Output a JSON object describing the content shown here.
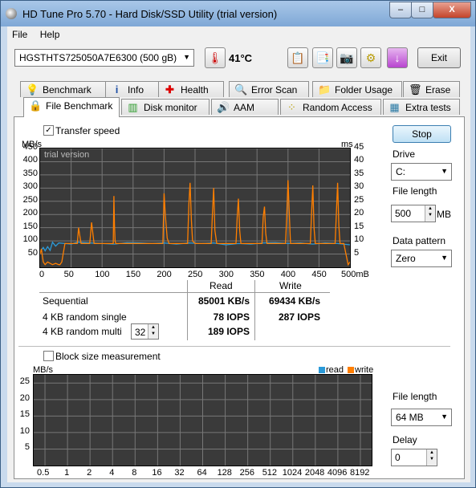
{
  "window": {
    "title": "HD Tune Pro 5.70 - Hard Disk/SSD Utility (trial version)",
    "minimize": "–",
    "maximize": "□",
    "close": "X"
  },
  "menu": [
    "File",
    "Help"
  ],
  "toolbar": {
    "drive": "HGSTHTS725050A7E6300 (500 gB)",
    "temperature": "41°C",
    "exit_label": "Exit"
  },
  "tabs_top": [
    "Benchmark",
    "Info",
    "Health",
    "Error Scan",
    "Folder Usage",
    "Erase"
  ],
  "tabs_bottom": [
    "File Benchmark",
    "Disk monitor",
    "AAM",
    "Random Access",
    "Extra tests"
  ],
  "transfer": {
    "checkbox_label": "Transfer speed",
    "left_unit": "MB/s",
    "right_unit": "ms",
    "watermark": "trial version",
    "y_ticks_left": [
      "450",
      "400",
      "350",
      "300",
      "250",
      "200",
      "150",
      "100",
      "50"
    ],
    "y_ticks_right": [
      "45",
      "40",
      "35",
      "30",
      "25",
      "20",
      "15",
      "10",
      "5"
    ],
    "x_ticks": [
      "0",
      "50",
      "100",
      "150",
      "200",
      "250",
      "300",
      "350",
      "400",
      "450",
      "500mB"
    ]
  },
  "results": {
    "col_read": "Read",
    "col_write": "Write",
    "rows": [
      {
        "label": "Sequential",
        "read": "85001 KB/s",
        "write": "69434 KB/s"
      },
      {
        "label": "4 KB random single",
        "read": "78 IOPS",
        "write": "287 IOPS"
      },
      {
        "label": "4 KB random multi",
        "read": "189 IOPS",
        "write": ""
      }
    ],
    "queue_depth": "32"
  },
  "right_panel": {
    "stop_label": "Stop",
    "drive_label": "Drive",
    "drive_value": "C:",
    "file_length_label": "File length",
    "file_length_value": "500",
    "file_length_unit": "MB",
    "data_pattern_label": "Data pattern",
    "data_pattern_value": "Zero"
  },
  "block": {
    "checkbox_label": "Block size measurement",
    "unit": "MB/s",
    "legend_read": "read",
    "legend_write": "write",
    "y_ticks": [
      "25",
      "20",
      "15",
      "10",
      "5"
    ],
    "x_ticks": [
      "0.5",
      "1",
      "2",
      "4",
      "8",
      "16",
      "32",
      "64",
      "128",
      "256",
      "512",
      "1024",
      "2048",
      "4096",
      "8192"
    ],
    "file_length_label": "File length",
    "file_length_value": "64 MB",
    "delay_label": "Delay",
    "delay_value": "0"
  },
  "colors": {
    "read": "#2b9ad8",
    "write": "#ff7f00",
    "plot_bg": "#3a3a3a",
    "grid": "#777777"
  },
  "chart_data": {
    "type": "line",
    "title": "",
    "xlabel": "",
    "ylabel": "MB/s",
    "xlim": [
      0,
      500
    ],
    "ylim": [
      0,
      450
    ],
    "y2label": "ms",
    "y2lim": [
      0,
      45
    ],
    "grid": true,
    "series": [
      {
        "axis": "left",
        "color": "#2b9ad8",
        "x": [
          0,
          5,
          8,
          12,
          16,
          20,
          25,
          30,
          40,
          50,
          60,
          80,
          100,
          120,
          140,
          160,
          180,
          200,
          220,
          240,
          260,
          280,
          300,
          320,
          340,
          360,
          380,
          400,
          420,
          440,
          460,
          480,
          500
        ],
        "y": [
          60,
          75,
          62,
          78,
          64,
          95,
          80,
          92,
          90,
          88,
          95,
          92,
          90,
          88,
          93,
          92,
          90,
          92,
          88,
          92,
          90,
          92,
          85,
          90,
          88,
          92,
          93,
          90,
          92,
          88,
          92,
          90,
          85
        ]
      },
      {
        "axis": "right",
        "color": "#ff7f00",
        "x": [
          0,
          2,
          5,
          8,
          10,
          12,
          20,
          25,
          30,
          32,
          35,
          40,
          50,
          60,
          62,
          64,
          66,
          80,
          83,
          85,
          87,
          90,
          100,
          110,
          118,
          119,
          120,
          121,
          122,
          130,
          140,
          150,
          160,
          170,
          180,
          190,
          198,
          200,
          202,
          205,
          208,
          210,
          220,
          230,
          238,
          240,
          242,
          244,
          246,
          250,
          260,
          270,
          276,
          278,
          280,
          282,
          285,
          290,
          300,
          310,
          316,
          318,
          320,
          322,
          324,
          330,
          340,
          350,
          358,
          360,
          362,
          364,
          366,
          370,
          380,
          390,
          396,
          398,
          400,
          402,
          404,
          410,
          420,
          430,
          436,
          438,
          440,
          442,
          444,
          450,
          460,
          470,
          476,
          478,
          480,
          482,
          484,
          490,
          497,
          500
        ],
        "y": [
          5,
          7,
          2,
          1,
          1.5,
          2,
          1,
          1.5,
          1,
          1,
          2,
          9,
          9,
          9,
          15,
          12,
          9,
          9,
          17,
          13,
          9,
          9,
          9,
          9,
          9,
          27,
          16,
          10,
          9,
          9,
          9,
          9,
          9,
          9,
          9,
          9,
          9,
          28,
          20,
          11,
          9,
          9,
          9,
          9,
          9,
          24,
          32,
          18,
          10,
          9,
          9,
          9,
          9,
          20,
          30,
          14,
          9,
          9,
          9,
          9,
          9,
          19,
          26,
          14,
          9,
          9,
          9,
          9,
          9,
          19,
          23,
          13,
          9,
          9,
          9,
          9,
          9,
          20,
          33,
          21,
          9,
          9,
          9,
          9,
          9,
          20,
          31,
          15,
          9,
          9,
          9,
          9,
          9,
          20,
          32,
          16,
          9,
          9,
          1,
          2
        ]
      }
    ]
  }
}
